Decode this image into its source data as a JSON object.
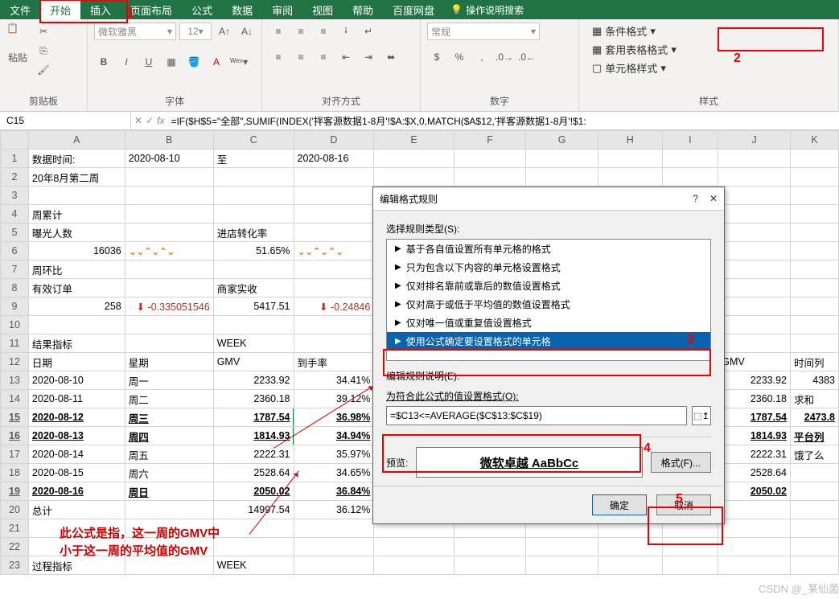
{
  "titlebar": {
    "tabs": [
      "文件",
      "开始",
      "插入",
      "页面布局",
      "公式",
      "数据",
      "审阅",
      "视图",
      "帮助",
      "百度网盘"
    ],
    "tell_me": "操作说明搜索"
  },
  "ribbon": {
    "clipboard": {
      "paste": "粘贴",
      "label": "剪贴板"
    },
    "font": {
      "family": "微软雅黑",
      "size": "12",
      "label": "字体",
      "bold": "B",
      "italic": "I",
      "underline": "U"
    },
    "align": {
      "label": "对齐方式"
    },
    "number": {
      "general": "常规",
      "label": "数字"
    },
    "styles": {
      "conditional": "条件格式",
      "table": "套用表格格式",
      "cell": "单元格样式",
      "label": "样式"
    }
  },
  "namebox": "C15",
  "formula": "=IF($H$5=\"全部\",SUMIF(INDEX('拌客源数据1-8月'!$A:$X,0,MATCH($A$12,'拌客源数据1-8月'!$1:",
  "cols": [
    "",
    "A",
    "B",
    "C",
    "D",
    "E",
    "F",
    "G",
    "H",
    "I",
    "J",
    "K"
  ],
  "rows": [
    {
      "n": 1,
      "A": "数据时间:",
      "B": "2020-08-10",
      "C": "至",
      "D": "2020-08-16"
    },
    {
      "n": 2,
      "A": "20年8月第二周"
    },
    {
      "n": 3
    },
    {
      "n": 4,
      "A": "周累计"
    },
    {
      "n": 5,
      "A": "曝光人数",
      "C": "进店转化率"
    },
    {
      "n": 6,
      "A": "16036",
      "B": "spark",
      "C": "51.65%",
      "D": "spark"
    },
    {
      "n": 7,
      "A": "周环比"
    },
    {
      "n": 8,
      "A": "有效订单",
      "C": "商家实收"
    },
    {
      "n": 9,
      "A": "258",
      "Barrow": true,
      "B": "-0.335051546",
      "C": "5417.51",
      "Darrow": true,
      "D": "-0.24846"
    },
    {
      "n": 10
    },
    {
      "n": 11,
      "A": "结果指标",
      "C": "WEEK"
    },
    {
      "n": 12,
      "A": "日期",
      "B": "星期",
      "C": "GMV",
      "D": "到手率",
      "J": "GMV",
      "K": "时间列"
    },
    {
      "n": 13,
      "A": "2020-08-10",
      "B": "周一",
      "C": "2233.92",
      "D": "34.41%",
      "J": "2233.92",
      "K": "4383"
    },
    {
      "n": 14,
      "A": "2020-08-11",
      "B": "周二",
      "C": "2360.18",
      "D": "39.12%",
      "J": "2360.18",
      "K": "求和"
    },
    {
      "n": 15,
      "A": "2020-08-12",
      "B": "周三",
      "C": "1787.54",
      "D": "36.98%",
      "J": "1787.54",
      "K": "2473.8",
      "bold": true
    },
    {
      "n": 16,
      "A": "2020-08-13",
      "B": "周四",
      "C": "1814.93",
      "D": "34.94%",
      "J": "1814.93",
      "K": "平台列",
      "bold": true
    },
    {
      "n": 17,
      "A": "2020-08-14",
      "B": "周五",
      "C": "2222.31",
      "D": "35.97%",
      "J": "2222.31",
      "K": "饿了么"
    },
    {
      "n": 18,
      "A": "2020-08-15",
      "B": "周六",
      "C": "2528.64",
      "D": "34.65%",
      "J": "2528.64"
    },
    {
      "n": 19,
      "A": "2020-08-16",
      "B": "周日",
      "C": "2050.02",
      "D": "36.84%",
      "J": "2050.02",
      "bold": true
    },
    {
      "n": 20,
      "A": "总计",
      "C": "14997.54",
      "D": "36.12%"
    },
    {
      "n": 21
    },
    {
      "n": 22
    },
    {
      "n": 23,
      "A": "过程指标",
      "C": "WEEK"
    }
  ],
  "annotation": {
    "l1": "此公式是指，这一周的GMV中",
    "l2": "小于这一周的平均值的GMV"
  },
  "dialog": {
    "title": "编辑格式规则",
    "sel_type": "选择规则类型(S):",
    "rules": [
      "基于各自值设置所有单元格的格式",
      "只为包含以下内容的单元格设置格式",
      "仅对排名靠前或靠后的数值设置格式",
      "仅对高于或低于平均值的数值设置格式",
      "仅对唯一值或重复值设置格式",
      "使用公式确定要设置格式的单元格"
    ],
    "edit_desc": "编辑规则说明(E):",
    "formula_label": "为符合此公式的值设置格式(O):",
    "formula_value": "=$C13<=AVERAGE($C$13:$C$19)",
    "preview_label": "预览:",
    "preview_text": "微软卓越 AaBbCc",
    "format_btn": "格式(F)...",
    "ok": "确定",
    "cancel": "取消"
  },
  "watermark": "CSDN @_某仙菌"
}
